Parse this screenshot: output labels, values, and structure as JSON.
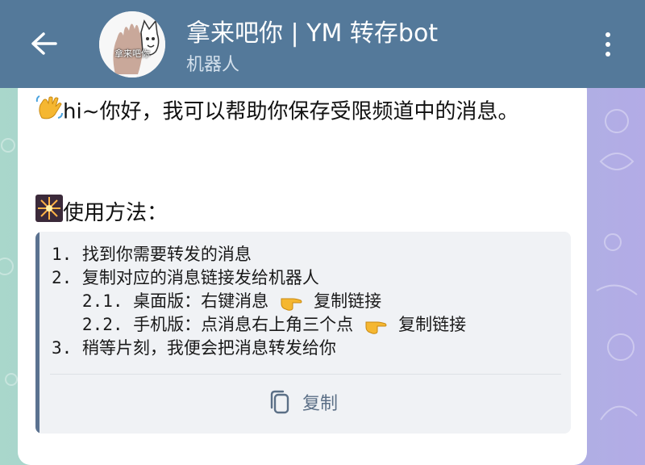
{
  "header": {
    "back_icon": "arrow-left-icon",
    "avatar_text": "拿来吧你",
    "title": "拿来吧你 | YM 转存bot",
    "subtitle": "机器人",
    "menu_icon": "more-vertical-icon"
  },
  "message": {
    "intro_emoji": "waving-hand-icon",
    "intro_text": "hi~你好，我可以帮助你保存受限频道中的消息。",
    "usage_emoji": "sparkler-icon",
    "usage_title": "使用方法：",
    "code": {
      "line1": "1. 找到你需要转发的消息",
      "line2": "2. 复制对应的消息链接发给机器人",
      "line3_a": "   2.1. 桌面版：右键消息",
      "line3_b": "复制链接",
      "line4_a": "   2.2. 手机版：点消息右上角三个点",
      "line4_b": "复制链接",
      "line5": "3. 稍等片刻，我便会把消息转发给你",
      "pointer_icon": "pointing-right-icon",
      "copy_icon": "copy-icon",
      "copy_label": "复制"
    }
  },
  "colors": {
    "header_bg": "#54799a",
    "bubble_bg": "#ffffff",
    "code_bg": "#f0f2f5",
    "code_bar": "#5b7290"
  }
}
